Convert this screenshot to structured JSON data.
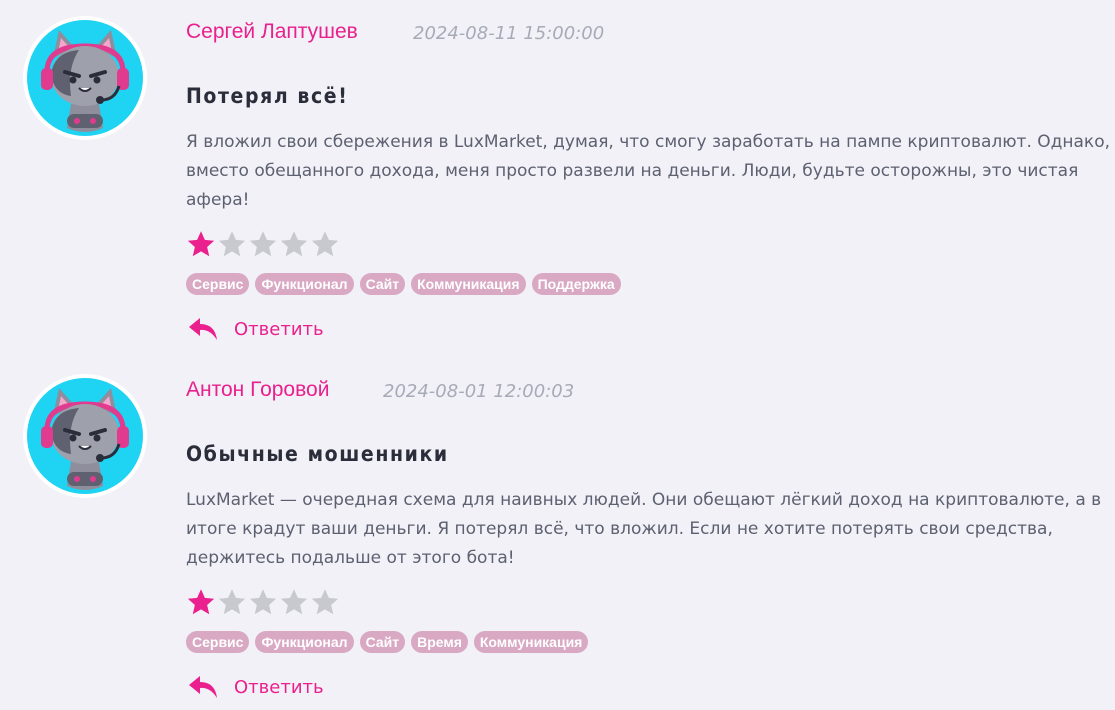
{
  "reviews": [
    {
      "author": "Сергей Лаптушев",
      "date": "2024-08-11 15:00:00",
      "title": "Потерял всё!",
      "text": "Я вложил свои сбережения в LuxMarket, думая, что смогу заработать на пампе криптовалют. Однако, вместо обещанного дохода, меня просто развели на деньги. Люди, будьте осторожны, это чистая афера!",
      "rating": 1,
      "max_rating": 5,
      "tags": [
        "Сервис",
        "Функционал",
        "Сайт",
        "Коммуникация",
        "Поддержка"
      ],
      "reply_label": "Ответить"
    },
    {
      "author": "Антон Горовой",
      "date": "2024-08-01 12:00:03",
      "title": "Обычные мошенники",
      "text": "LuxMarket — очередная схема для наивных людей. Они обещают лёгкий доход на криптовалюте, а в итоге крадут ваши деньги. Я потерял всё, что вложил. Если не хотите потерять свои средства, держитесь подальше от этого бота!",
      "rating": 1,
      "max_rating": 5,
      "tags": [
        "Сервис",
        "Функционал",
        "Сайт",
        "Время",
        "Коммуникация"
      ],
      "reply_label": "Ответить"
    }
  ],
  "colors": {
    "background": "#f1f1f7",
    "accent": "#e9208d",
    "tag_bg": "#d9a8c3",
    "star_filled": "#e9208d",
    "star_empty": "#c8c9cf",
    "avatar_bg": "#1fd3f2"
  },
  "icons": {
    "avatar": "gamer-cat-avatar",
    "star": "star-icon",
    "reply": "reply-arrow-icon"
  }
}
